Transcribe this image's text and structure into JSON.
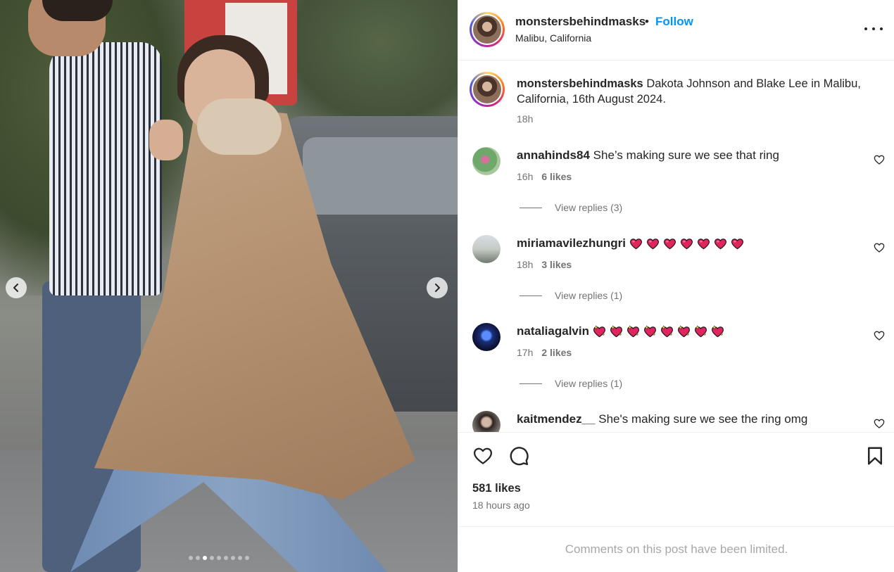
{
  "post": {
    "username": "monstersbehindmasks",
    "separator": "•",
    "follow_label": "Follow",
    "location": "Malibu, California",
    "image_alt": "Dakota Johnson and Blake Lee walking in Malibu",
    "carousel": {
      "dot_count": 9,
      "active_index": 2
    }
  },
  "caption": {
    "username": "monstersbehindmasks",
    "text": "Dakota Johnson and Blake Lee in Malibu, California, 16th August 2024.",
    "time": "18h"
  },
  "comments": [
    {
      "username": "annahinds84",
      "text": "She’s making sure we see that ring",
      "time": "16h",
      "likes": "6 likes",
      "replies": "View replies (3)",
      "emoji": ""
    },
    {
      "username": "miriamavilezhungri",
      "text": "",
      "time": "18h",
      "likes": "3 likes",
      "replies": "View replies (1)",
      "emoji": "red-heart",
      "emoji_count": 7
    },
    {
      "username": "nataliagalvin",
      "text": "",
      "time": "17h",
      "likes": "2 likes",
      "replies": "View replies (1)",
      "emoji": "sparkling-heart",
      "emoji_count": 8
    },
    {
      "username": "kaitmendez__",
      "text": "She's making sure we see the ring omg",
      "time": "",
      "likes": "",
      "replies": "",
      "emoji": ""
    }
  ],
  "stats": {
    "likes": "581 likes",
    "time_ago": "18 hours ago"
  },
  "footer": {
    "limited_text": "Comments on this post have been limited."
  },
  "colors": {
    "accent": "#0095f6",
    "text": "#262626",
    "muted": "#737373",
    "border": "#efefef",
    "heart_red": "#e0245e"
  }
}
